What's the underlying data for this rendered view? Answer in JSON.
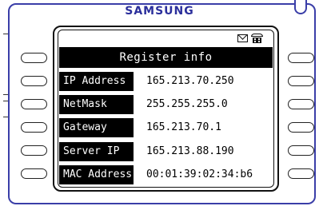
{
  "device": {
    "brand": "SAMSUNG",
    "accent_color": "#3a3ea8"
  },
  "status_icons": [
    "mail-icon",
    "phone-icon"
  ],
  "screen": {
    "title": "Register info",
    "rows": [
      {
        "label": "IP Address",
        "value": "165.213.70.250"
      },
      {
        "label": "NetMask",
        "value": "255.255.255.0"
      },
      {
        "label": "Gateway",
        "value": "165.213.70.1"
      },
      {
        "label": "Server IP",
        "value": "165.213.88.190"
      },
      {
        "label": "MAC Address",
        "value": "00:01:39:02:34:b6"
      }
    ]
  }
}
